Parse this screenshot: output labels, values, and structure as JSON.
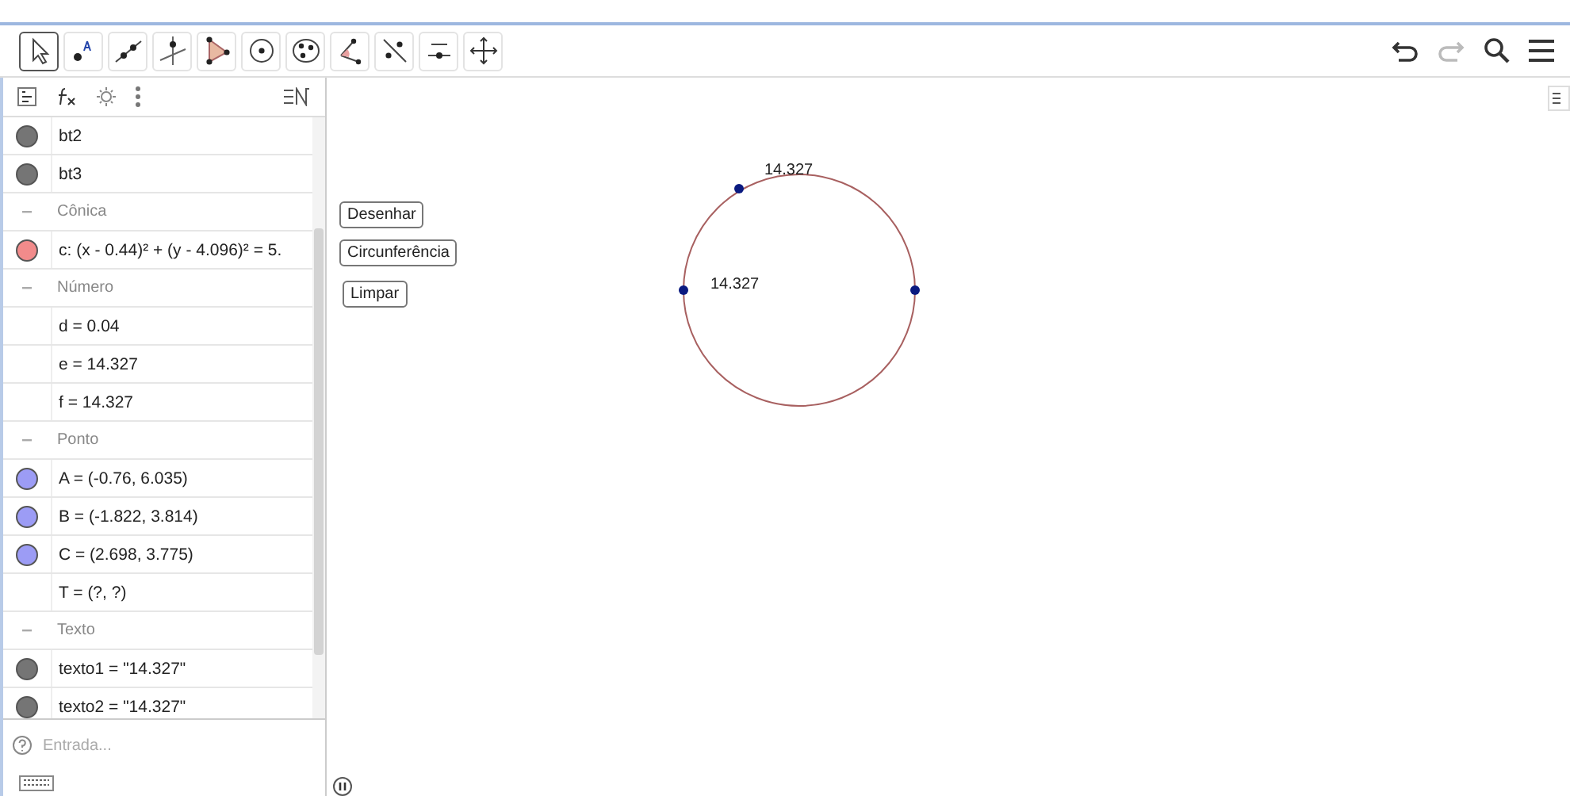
{
  "toolbar": {
    "tools": [
      {
        "kind": "move",
        "selected": true
      },
      {
        "kind": "point",
        "selected": false
      },
      {
        "kind": "line",
        "selected": false
      },
      {
        "kind": "perpendicular",
        "selected": false
      },
      {
        "kind": "polygon",
        "selected": false
      },
      {
        "kind": "circle",
        "selected": false
      },
      {
        "kind": "conic",
        "selected": false
      },
      {
        "kind": "angle",
        "selected": false
      },
      {
        "kind": "reflect",
        "selected": false
      },
      {
        "kind": "slider",
        "selected": false
      },
      {
        "kind": "pan",
        "selected": false
      }
    ]
  },
  "algebra": {
    "rows": [
      {
        "kind": "item",
        "visible": true,
        "color": "#757575",
        "text": "bt2"
      },
      {
        "kind": "item",
        "visible": true,
        "color": "#757575",
        "text": "bt3"
      },
      {
        "kind": "header",
        "text": "Cônica"
      },
      {
        "kind": "item",
        "visible": true,
        "color": "#f28b8b",
        "text": "c: (x - 0.44)² + (y - 4.096)² = 5."
      },
      {
        "kind": "header",
        "text": "Número"
      },
      {
        "kind": "item",
        "visible": false,
        "text": "d = 0.04"
      },
      {
        "kind": "item",
        "visible": false,
        "text": "e = 14.327"
      },
      {
        "kind": "item",
        "visible": false,
        "text": "f = 14.327"
      },
      {
        "kind": "header",
        "text": "Ponto"
      },
      {
        "kind": "item",
        "visible": true,
        "color": "#9c9cf5",
        "text": "A = (-0.76, 6.035)"
      },
      {
        "kind": "item",
        "visible": true,
        "color": "#9c9cf5",
        "text": "B = (-1.822, 3.814)"
      },
      {
        "kind": "item",
        "visible": true,
        "color": "#9c9cf5",
        "text": "C = (2.698, 3.775)"
      },
      {
        "kind": "item",
        "visible": false,
        "text": "T = (?, ?)"
      },
      {
        "kind": "header",
        "text": "Texto"
      },
      {
        "kind": "item",
        "visible": true,
        "color": "#757575",
        "text": "texto1 = \"14.327\""
      },
      {
        "kind": "item",
        "visible": true,
        "color": "#757575",
        "text": "texto2 = \"14.327\""
      }
    ],
    "input": {
      "placeholder": "Entrada..."
    }
  },
  "canvas": {
    "buttons": [
      "Desenhar",
      "Circunferência",
      "Limpar"
    ],
    "labels": [
      "14.327",
      "14.327"
    ]
  }
}
